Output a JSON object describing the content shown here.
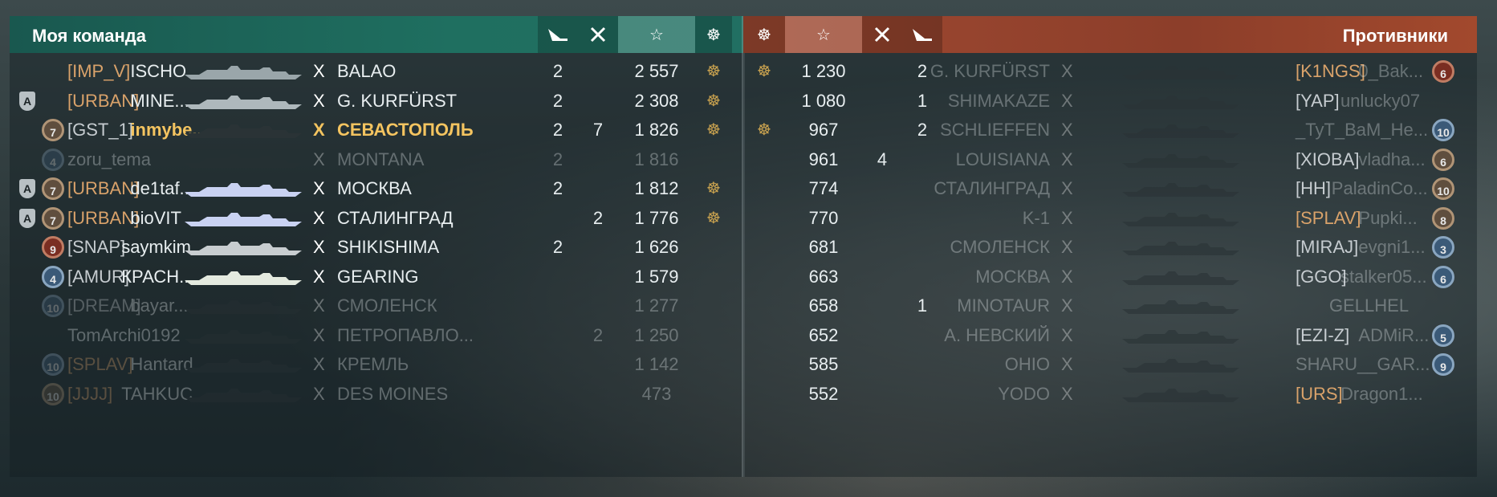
{
  "left": {
    "title": "Моя команда",
    "header_icons": [
      "torpedo-icon",
      "plane-shot-icon",
      "star-icon",
      "anchor-medal-icon"
    ],
    "header_star": "☆",
    "header_medal": "☸",
    "rows": [
      {
        "level": "",
        "admin": "",
        "tag": "[IMP_V]",
        "tag_color": "orange",
        "name": "ISCHO...",
        "ship": "BALAO",
        "ship_color": "#9aa6aa",
        "c1": "2",
        "c2": "",
        "score": "2 557",
        "medal": "☸",
        "dim": false,
        "self": false
      },
      {
        "level": "",
        "admin": "A",
        "tag": "[URBAN]",
        "tag_color": "orange",
        "name": "MINE...",
        "ship": "G. KURFÜRST",
        "ship_color": "#aeb8bc",
        "c1": "2",
        "c2": "",
        "score": "2 308",
        "medal": "☸",
        "dim": false,
        "self": false
      },
      {
        "level": "7",
        "level_color": "brown",
        "admin": "",
        "tag": "[GST_1]",
        "tag_color": "gray",
        "name": "inmybe...",
        "ship": "СЕВАСТОПОЛЬ",
        "ship_color": "#2a3336",
        "c1": "2",
        "c2": "7",
        "score": "1 826",
        "medal": "☸",
        "dim": false,
        "self": true
      },
      {
        "level": "4",
        "level_color": "blue",
        "admin": "",
        "tag": "",
        "tag_color": "",
        "name": "zoru_tema",
        "ship": "MONTANA",
        "ship_color": "#2a3336",
        "c1": "2",
        "c2": "",
        "score": "1 816",
        "medal": "",
        "dim": true,
        "self": false
      },
      {
        "level": "7",
        "level_color": "brown",
        "admin": "A",
        "tag": "[URBAN]",
        "tag_color": "orange",
        "name": "de1taf...",
        "ship": "МОСКВА",
        "ship_color": "#c9d2f2",
        "c1": "2",
        "c2": "",
        "score": "1 812",
        "medal": "☸",
        "dim": false,
        "self": false
      },
      {
        "level": "7",
        "level_color": "brown",
        "admin": "A",
        "tag": "[URBAN]",
        "tag_color": "orange",
        "name": "bioVIT",
        "ship": "СТАЛИНГРАД",
        "ship_color": "#c9d2f2",
        "c1": "",
        "c2": "2",
        "score": "1 776",
        "medal": "☸",
        "dim": false,
        "self": false
      },
      {
        "level": "9",
        "level_color": "red",
        "admin": "",
        "tag": "[SNAP]",
        "tag_color": "gray",
        "name": "saymkim",
        "ship": "SHIKISHIMA",
        "ship_color": "#c8cdd0",
        "c1": "2",
        "c2": "",
        "score": "1 626",
        "medal": "",
        "dim": false,
        "self": false
      },
      {
        "level": "4",
        "level_color": "blue",
        "admin": "",
        "tag": "[AMUR]",
        "tag_color": "gray",
        "name": "КРАСН...",
        "ship": "GEARING",
        "ship_color": "#e4eadf",
        "c1": "",
        "c2": "",
        "score": "1 579",
        "medal": "",
        "dim": false,
        "self": false
      },
      {
        "level": "10",
        "level_color": "blue",
        "admin": "",
        "tag": "[DREAM]",
        "tag_color": "gray",
        "name": "bayar...",
        "ship": "СМОЛЕНСК",
        "ship_color": "#2a3336",
        "c1": "",
        "c2": "",
        "score": "1 277",
        "medal": "",
        "dim": true,
        "self": false
      },
      {
        "level": "",
        "admin": "",
        "tag": "",
        "tag_color": "",
        "name": "TomArchi0192",
        "ship": "ПЕТРОПАВЛО...",
        "ship_color": "#2a3336",
        "c1": "",
        "c2": "2",
        "score": "1 250",
        "medal": "",
        "dim": true,
        "self": false
      },
      {
        "level": "10",
        "level_color": "blue",
        "admin": "",
        "tag": "[SPLAV]",
        "tag_color": "orange",
        "name": "Hantard",
        "ship": "КРЕМЛЬ",
        "ship_color": "#2a3336",
        "c1": "",
        "c2": "",
        "score": "1 142",
        "medal": "",
        "dim": true,
        "self": false
      },
      {
        "level": "10",
        "level_color": "brown",
        "admin": "",
        "tag": "[JJJJ]",
        "tag_color": "orange",
        "name": "TAHKUC...",
        "ship": "DES MOINES",
        "ship_color": "#2a3336",
        "c1": "",
        "c2": "",
        "score": "473",
        "medal": "",
        "dim": true,
        "self": false
      }
    ]
  },
  "right": {
    "title": "Противники",
    "header_star": "☆",
    "header_medal": "☸",
    "rows": [
      {
        "medal": "☸",
        "score": "1 230",
        "c2": "",
        "c1": "2",
        "ship": "G. KURFÜRST",
        "tag": "[K1NGS]",
        "name": "0_Bak...",
        "level": "6",
        "level_color": "red"
      },
      {
        "medal": "",
        "score": "1 080",
        "c2": "",
        "c1": "1",
        "ship": "SHIMAKAZE",
        "tag": "[YAP]",
        "name": "unlucky07",
        "level": "",
        "level_color": ""
      },
      {
        "medal": "☸",
        "score": "967",
        "c2": "",
        "c1": "2",
        "ship": "SCHLIEFFEN",
        "tag": "",
        "name": "_TyT_BaM_He...",
        "level": "10",
        "level_color": "blue"
      },
      {
        "medal": "",
        "score": "961",
        "c2": "4",
        "c1": "",
        "ship": "LOUISIANA",
        "tag": "[XIOBA]",
        "name": "vladha...",
        "level": "6",
        "level_color": "brown"
      },
      {
        "medal": "",
        "score": "774",
        "c2": "",
        "c1": "",
        "ship": "СТАЛИНГРАД",
        "tag": "[HH]",
        "name": "PaladinCo...",
        "level": "10",
        "level_color": "brown"
      },
      {
        "medal": "",
        "score": "770",
        "c2": "",
        "c1": "",
        "ship": "K-1",
        "tag": "[SPLAV]",
        "name": "Pupki...",
        "level": "8",
        "level_color": "brown"
      },
      {
        "medal": "",
        "score": "681",
        "c2": "",
        "c1": "",
        "ship": "СМОЛЕНСК",
        "tag": "[MIRAJ]",
        "name": "evgni1...",
        "level": "3",
        "level_color": "blue"
      },
      {
        "medal": "",
        "score": "663",
        "c2": "",
        "c1": "",
        "ship": "МОСКВА",
        "tag": "[GGO]",
        "name": "stalker05...",
        "level": "6",
        "level_color": "blue"
      },
      {
        "medal": "",
        "score": "658",
        "c2": "",
        "c1": "1",
        "ship": "MINOTAUR",
        "tag": "",
        "name": "GELLHEL",
        "level": "",
        "level_color": ""
      },
      {
        "medal": "",
        "score": "652",
        "c2": "",
        "c1": "",
        "ship": "А. НЕВСКИЙ",
        "tag": "[EZI-Z]",
        "name": "ADMiR...",
        "level": "5",
        "level_color": "blue"
      },
      {
        "medal": "",
        "score": "585",
        "c2": "",
        "c1": "",
        "ship": "OHIO",
        "tag": "",
        "name": "SHARU__GAR...",
        "level": "9",
        "level_color": "blue"
      },
      {
        "medal": "",
        "score": "552",
        "c2": "",
        "c1": "",
        "ship": "YODO",
        "tag": "[URS]",
        "name": "Dragon1...",
        "level": "",
        "level_color": ""
      }
    ]
  }
}
